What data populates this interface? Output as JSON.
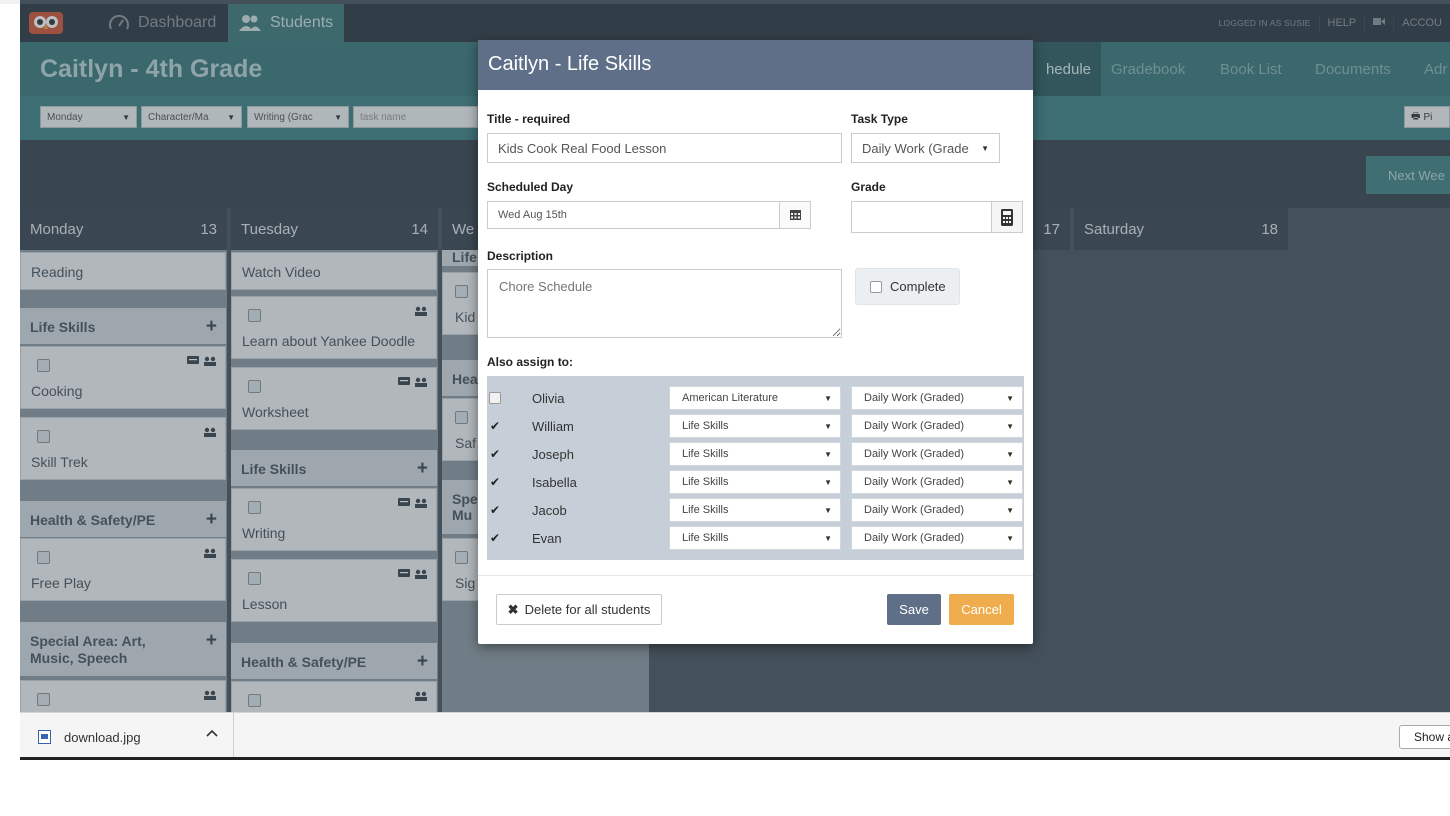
{
  "nav": {
    "tabs": [
      {
        "label": "Dashboard",
        "icon": "speedometer-icon"
      },
      {
        "label": "Students",
        "icon": "users-icon"
      }
    ],
    "right": [
      "LOGGED IN AS SUSIE",
      "HELP",
      "ACCOU"
    ]
  },
  "header": {
    "title": "Caitlyn - 4th Grade",
    "subnav": [
      "hedule",
      "Gradebook",
      "Book List",
      "Documents",
      "Adr"
    ]
  },
  "filters": {
    "day": "Monday",
    "subject": "Character/Ma",
    "type": "Writing (Grac",
    "task_placeholder": "task name",
    "print_label": "Pi"
  },
  "next_week_label": "Next Wee",
  "days": [
    {
      "name": "Monday",
      "num": "13"
    },
    {
      "name": "Tuesday",
      "num": "14"
    },
    {
      "name": "We",
      "num": ""
    },
    {
      "name": "",
      "num": "17"
    },
    {
      "name": "Saturday",
      "num": "18"
    }
  ],
  "monday": {
    "reading": "Reading",
    "life_skills": "Life Skills",
    "cooking": "Cooking",
    "skill_trek": "Skill Trek",
    "health": "Health & Safety/PE",
    "free_play": "Free Play",
    "special_area": "Special Area: Art, Music, Speech"
  },
  "tuesday": {
    "watch_video": "Watch Video",
    "yankee": "Learn about Yankee Doodle",
    "worksheet": "Worksheet",
    "life_skills": "Life Skills",
    "writing": "Writing",
    "lesson": "Lesson",
    "health": "Health & Safety/PE"
  },
  "wednesday": {
    "life": "Life",
    "kid": "Kid",
    "hea": "Hea",
    "saf": "Saf",
    "spe": "Spe",
    "mu": "Mu",
    "sig": "Sig"
  },
  "modal": {
    "title": "Caitlyn - Life Skills",
    "title_label": "Title - required",
    "title_value": "Kids Cook Real Food Lesson",
    "task_type_label": "Task Type",
    "task_type_value": "Daily Work (Grade",
    "day_label": "Scheduled Day",
    "day_value": "Wed Aug 15th",
    "grade_label": "Grade",
    "grade_value": "",
    "desc_label": "Description",
    "desc_placeholder": "Chore Schedule",
    "complete_label": "Complete",
    "also_assign_label": "Also assign to:",
    "assign": [
      {
        "name": "Olivia",
        "checked": false,
        "subject": "American Literature",
        "type": "Daily Work (Graded)"
      },
      {
        "name": "William",
        "checked": true,
        "subject": "Life Skills",
        "type": "Daily Work (Graded)"
      },
      {
        "name": "Joseph",
        "checked": true,
        "subject": "Life Skills",
        "type": "Daily Work (Graded)"
      },
      {
        "name": "Isabella",
        "checked": true,
        "subject": "Life Skills",
        "type": "Daily Work (Graded)"
      },
      {
        "name": "Jacob",
        "checked": true,
        "subject": "Life Skills",
        "type": "Daily Work (Graded)"
      },
      {
        "name": "Evan",
        "checked": true,
        "subject": "Life Skills",
        "type": "Daily Work (Graded)"
      }
    ],
    "delete_label": "Delete for all students",
    "save_label": "Save",
    "cancel_label": "Cancel"
  },
  "downloads": {
    "file": "download.jpg",
    "show_all": "Show a"
  },
  "colors": {
    "modal_header": "#5f6f88",
    "cancel": "#f0ad4e",
    "teal": "#3a7a7d"
  }
}
